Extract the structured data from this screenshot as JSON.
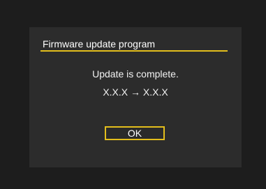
{
  "dialog": {
    "title": "Firmware update program",
    "message": "Update is complete.",
    "version_text": "X.X.X → X.X.X",
    "ok_label": "OK"
  },
  "colors": {
    "screen_background": "#1d1d1d",
    "dialog_background": "#2c2c2c",
    "accent_yellow": "#e3be1c",
    "text": "#ffffff"
  }
}
